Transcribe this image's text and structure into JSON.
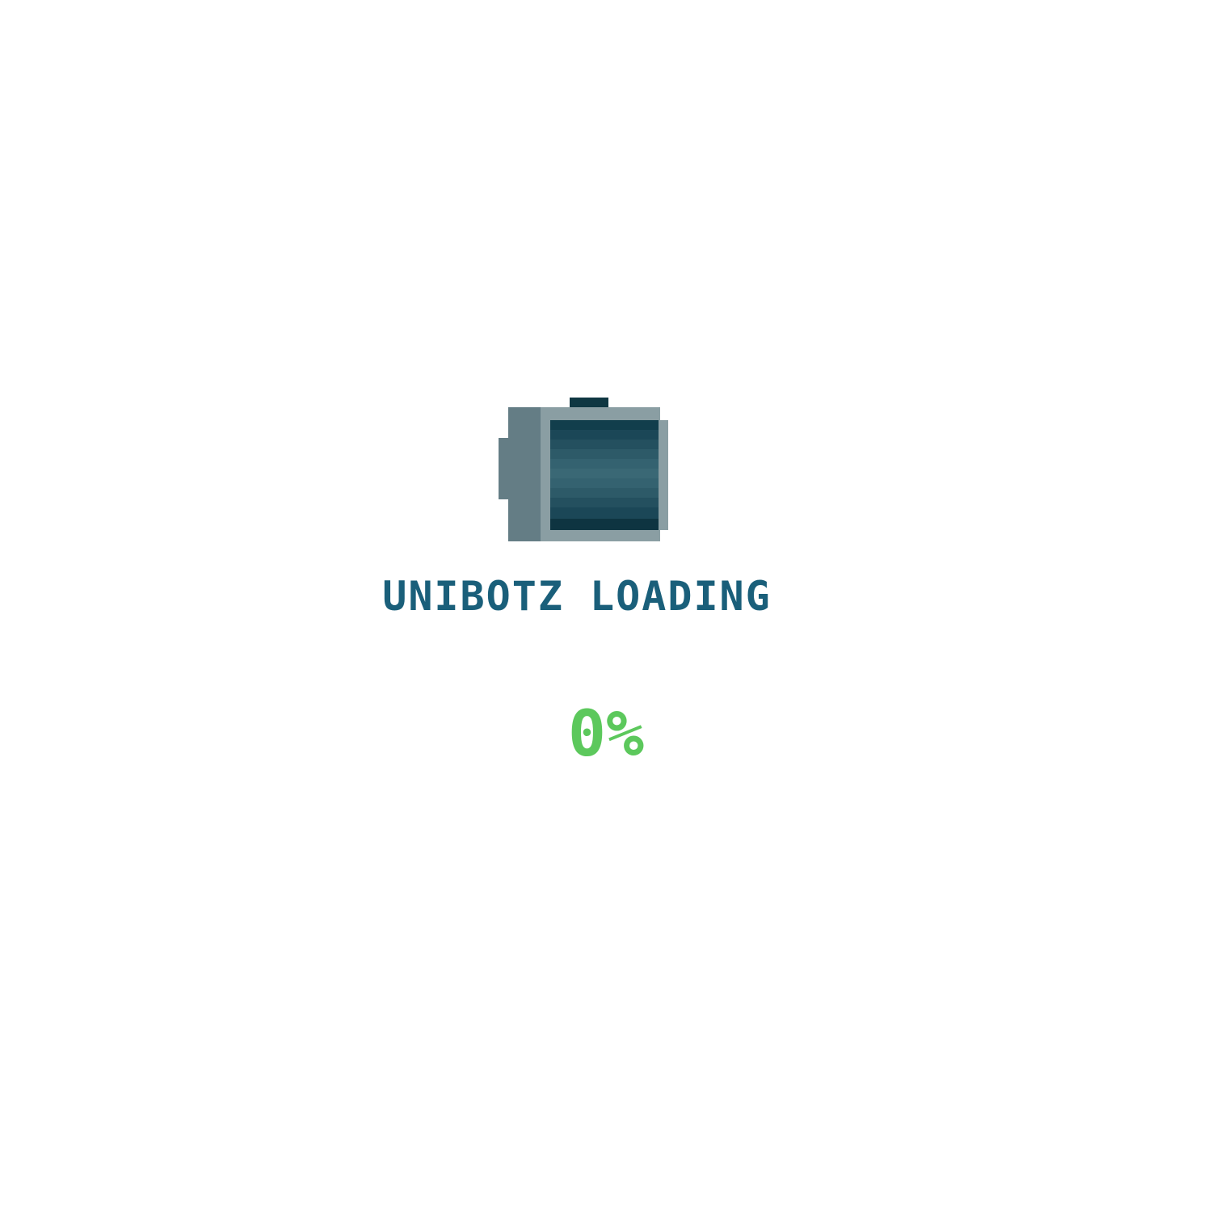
{
  "loader": {
    "title": "UNIBOTZ LOADING",
    "progress_text": "0%",
    "progress_value": 0,
    "icon": "pixel-battery-cylinder-icon"
  },
  "colors": {
    "background": "#ffffff",
    "title": "#1a5f7a",
    "progress": "#5cc85c",
    "icon_body_dark": "#123e4c",
    "icon_body_mid": "#2d5a68",
    "icon_frame": "#8a9ea3",
    "icon_cap": "#647d85",
    "icon_terminal": "#0f3742"
  }
}
